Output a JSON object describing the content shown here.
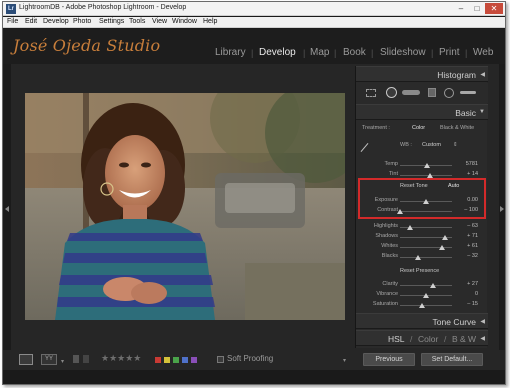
{
  "window": {
    "title": "LightroomDB - Adobe Photoshop Lightroom - Develop",
    "app_icon": "Lr",
    "controls": {
      "minimize": "–",
      "maximize": "□",
      "close": "✕"
    }
  },
  "menu": [
    "File",
    "Edit",
    "Develop",
    "Photo",
    "Settings",
    "Tools",
    "View",
    "Window",
    "Help"
  ],
  "identity_plate": "José Ojeda Studio",
  "modules": [
    "Library",
    "Develop",
    "Map",
    "Book",
    "Slideshow",
    "Print",
    "Web"
  ],
  "active_module": "Develop",
  "panels": {
    "histogram": "Histogram",
    "basic": {
      "title": "Basic",
      "treatment_label": "Treatment :",
      "treatment_options": [
        "Color",
        "Black & White"
      ],
      "wb_label": "WB :",
      "wb_value": "Custom",
      "sliders": [
        {
          "label": "Temp",
          "value": "5781",
          "level": 0.52
        },
        {
          "label": "Tint",
          "value": "+ 14",
          "level": 0.57
        }
      ],
      "tone_header": "Reset Tone",
      "tone_auto": "Auto",
      "tone_sliders": [
        {
          "label": "Exposure",
          "value": "0.00",
          "level": 0.5
        },
        {
          "label": "Contrast",
          "value": "– 100",
          "level": 0.0
        }
      ],
      "region_sliders": [
        {
          "label": "Highlights",
          "value": "– 63",
          "level": 0.19
        },
        {
          "label": "Shadows",
          "value": "+ 71",
          "level": 0.86
        },
        {
          "label": "Whites",
          "value": "+ 61",
          "level": 0.81
        },
        {
          "label": "Blacks",
          "value": "– 32",
          "level": 0.34
        }
      ],
      "presence_header": "Reset Presence",
      "presence_sliders": [
        {
          "label": "Clarity",
          "value": "+ 27",
          "level": 0.64
        },
        {
          "label": "Vibrance",
          "value": "0",
          "level": 0.5
        },
        {
          "label": "Saturation",
          "value": "– 15",
          "level": 0.43
        }
      ]
    },
    "tone_curve": "Tone Curve",
    "hsl": {
      "hsl": "HSL",
      "sep": "/",
      "color": "Color",
      "bw": "B & W"
    }
  },
  "toolbar": {
    "soft_proofing": "Soft Proofing",
    "rating": "★★★★★",
    "color_labels": [
      "#c83a34",
      "#d4c23a",
      "#4aa34a",
      "#4f71c9",
      "#8a4fb8"
    ],
    "previous": "Previous",
    "set_default": "Set Default..."
  }
}
